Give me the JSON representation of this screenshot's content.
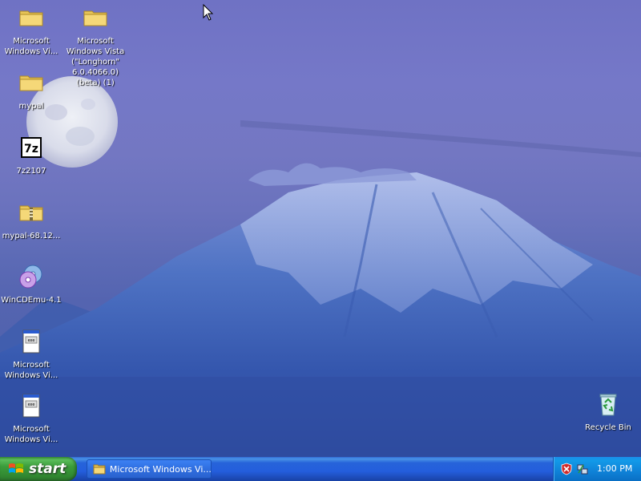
{
  "desktop": {
    "icons": [
      {
        "label": "Microsoft Windows Vi...",
        "icon": "folder-icon"
      },
      {
        "label": "Microsoft Windows Vista (\"Longhorn\" 6.0.4066.0) (beta) (1)",
        "icon": "folder-icon"
      },
      {
        "label": "mypal",
        "icon": "folder-icon"
      },
      {
        "label": "7z2107",
        "icon": "7zip-icon"
      },
      {
        "label": "mypal-68.12...",
        "icon": "zip-folder-icon"
      },
      {
        "label": "WinCDEmu-4.1",
        "icon": "cd-icon"
      },
      {
        "label": "Microsoft Windows Vi...",
        "icon": "document-icon"
      },
      {
        "label": "Microsoft Windows Vi...",
        "icon": "document-icon"
      },
      {
        "label": "Recycle Bin",
        "icon": "recycle-bin-icon"
      }
    ]
  },
  "taskbar": {
    "start_label": "start",
    "window_button_label": "Microsoft Windows Vi...",
    "clock": "1:00 PM",
    "tray_icons": [
      "security-alert-icon",
      "network-icon"
    ]
  },
  "colors": {
    "taskbar_blue": "#245edc",
    "start_green": "#3b9c3b",
    "tray_blue": "#0f82d8"
  }
}
